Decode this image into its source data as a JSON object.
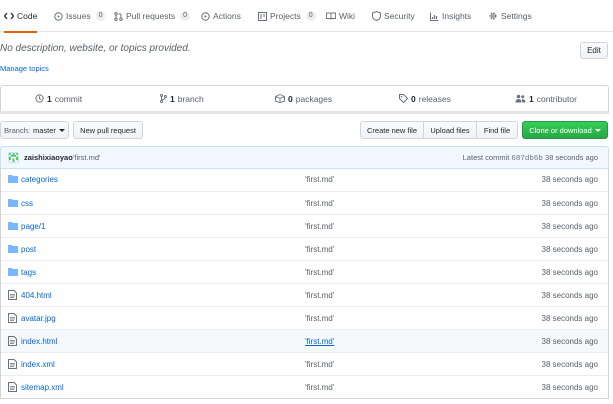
{
  "colors": {
    "accent": "#0366d6",
    "green": "#28a745",
    "tab_indicator": "#e36209",
    "folder": "#79b8ff"
  },
  "tabs": [
    {
      "label": "Code",
      "icon": "code-icon",
      "selected": true
    },
    {
      "label": "Issues",
      "icon": "issue-icon",
      "count": "0"
    },
    {
      "label": "Pull requests",
      "icon": "pull-request-icon",
      "count": "0"
    },
    {
      "label": "Actions",
      "icon": "play-icon"
    },
    {
      "label": "Projects",
      "icon": "project-icon",
      "count": "0"
    },
    {
      "label": "Wiki",
      "icon": "book-icon"
    },
    {
      "label": "Security",
      "icon": "shield-icon"
    },
    {
      "label": "Insights",
      "icon": "graph-icon"
    },
    {
      "label": "Settings",
      "icon": "gear-icon"
    }
  ],
  "repo": {
    "description": "No description, website, or topics provided.",
    "manage_topics": "Manage topics",
    "edit_label": "Edit"
  },
  "summary": {
    "commits": {
      "count": "1",
      "label": "commit"
    },
    "branches": {
      "count": "1",
      "label": "branch"
    },
    "packages": {
      "count": "0",
      "label": "packages"
    },
    "releases": {
      "count": "0",
      "label": "releases"
    },
    "contributors": {
      "count": "1",
      "label": "contributor"
    }
  },
  "toolbar": {
    "branch_prefix": "Branch:",
    "branch_name": "master",
    "new_pr": "New pull request",
    "create_file": "Create new file",
    "upload_files": "Upload files",
    "find_file": "Find file",
    "clone": "Clone or download"
  },
  "commit": {
    "author": "zaishixiaoyao",
    "message": "'first.md'",
    "latest_label": "Latest commit",
    "sha": "687db6b",
    "age": "38 seconds ago"
  },
  "files": [
    {
      "name": "categories",
      "type": "folder",
      "message": "'first.md'",
      "age": "38 seconds ago"
    },
    {
      "name": "css",
      "type": "folder",
      "message": "'first.md'",
      "age": "38 seconds ago"
    },
    {
      "name": "page/1",
      "type": "folder",
      "message": "'first.md'",
      "age": "38 seconds ago"
    },
    {
      "name": "post",
      "type": "folder",
      "message": "'first.md'",
      "age": "38 seconds ago"
    },
    {
      "name": "tags",
      "type": "folder",
      "message": "'first.md'",
      "age": "38 seconds ago"
    },
    {
      "name": "404.html",
      "type": "file",
      "message": "'first.md'",
      "age": "38 seconds ago"
    },
    {
      "name": "avatar.jpg",
      "type": "file",
      "message": "'first.md'",
      "age": "38 seconds ago"
    },
    {
      "name": "index.html",
      "type": "file",
      "message": "'first.md'",
      "age": "38 seconds ago"
    },
    {
      "name": "index.xml",
      "type": "file",
      "message": "'first.md'",
      "age": "38 seconds ago"
    },
    {
      "name": "sitemap.xml",
      "type": "file",
      "message": "'first.md'",
      "age": "38 seconds ago"
    }
  ]
}
